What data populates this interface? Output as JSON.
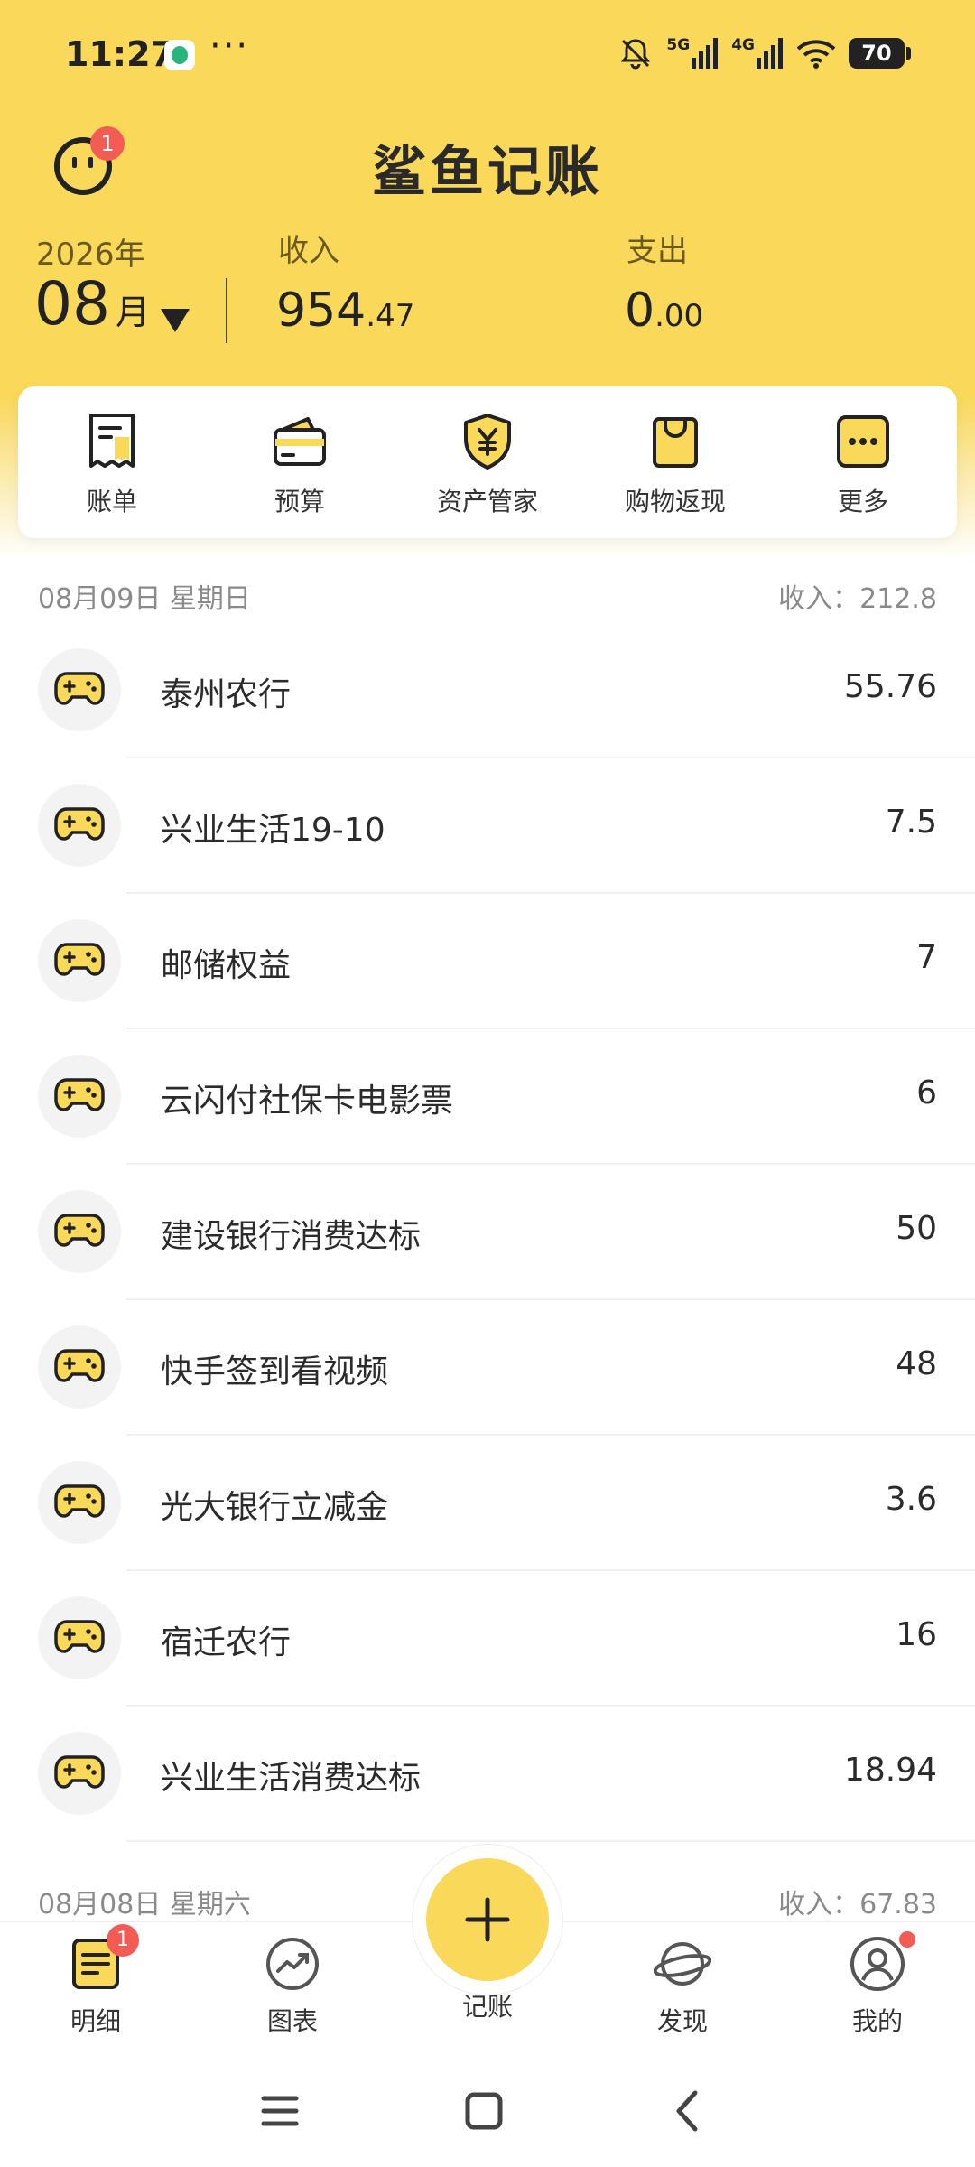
{
  "status_bar": {
    "time": "11:27",
    "more": "···",
    "network_5g": "5G",
    "network_4g": "4G",
    "battery": "70"
  },
  "header": {
    "title": "鲨鱼记账",
    "notification_count": "1"
  },
  "summary": {
    "year": "2026年",
    "month": "08",
    "month_unit": "月",
    "income_label": "收入",
    "income_int": "954",
    "income_dec": ".47",
    "expense_label": "支出",
    "expense_int": "0",
    "expense_dec": ".00"
  },
  "quick_menu": [
    {
      "label": "账单",
      "icon": "bill-icon"
    },
    {
      "label": "预算",
      "icon": "budget-wallet-icon"
    },
    {
      "label": "资产管家",
      "icon": "asset-shield-icon"
    },
    {
      "label": "购物返现",
      "icon": "shopping-bag-icon"
    },
    {
      "label": "更多",
      "icon": "more-icon"
    }
  ],
  "days": [
    {
      "date": "08月09日 星期日",
      "income_label": "收入：",
      "income_value": "212.8",
      "entries": [
        {
          "name": "泰州农行",
          "amount": "55.76",
          "icon": "gamepad-icon"
        },
        {
          "name": "兴业生活19-10",
          "amount": "7.5",
          "icon": "gamepad-icon"
        },
        {
          "name": "邮储权益",
          "amount": "7",
          "icon": "gamepad-icon"
        },
        {
          "name": "云闪付社保卡电影票",
          "amount": "6",
          "icon": "gamepad-icon"
        },
        {
          "name": "建设银行消费达标",
          "amount": "50",
          "icon": "gamepad-icon"
        },
        {
          "name": "快手签到看视频",
          "amount": "48",
          "icon": "gamepad-icon"
        },
        {
          "name": "光大银行立减金",
          "amount": "3.6",
          "icon": "gamepad-icon"
        },
        {
          "name": "宿迁农行",
          "amount": "16",
          "icon": "gamepad-icon"
        },
        {
          "name": "兴业生活消费达标",
          "amount": "18.94",
          "icon": "gamepad-icon"
        }
      ]
    },
    {
      "date": "08月08日 星期六",
      "income_label": "收入：",
      "income_value": "67.83"
    }
  ],
  "bottom_nav": [
    {
      "label": "明细",
      "icon": "details-list-icon",
      "badge": "1"
    },
    {
      "label": "图表",
      "icon": "chart-icon"
    },
    {
      "label": "记账",
      "icon": "plus-icon"
    },
    {
      "label": "发现",
      "icon": "planet-icon"
    },
    {
      "label": "我的",
      "icon": "profile-icon"
    }
  ],
  "colors": {
    "brand_yellow": "#f9d85a",
    "badge_red": "#f25c54",
    "text_dark": "#2b2b2b",
    "text_muted": "#8a8a8a"
  }
}
